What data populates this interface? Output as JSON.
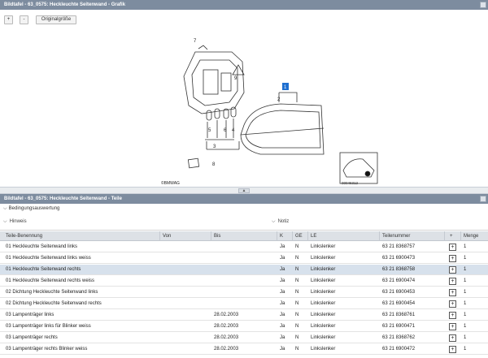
{
  "graphic_panel": {
    "title": "Bildtafel - 63_0575: Heckleuchte Seitenwand - Grafik",
    "toolbar": {
      "zoom_in": "+",
      "zoom_out": "-",
      "original_size": "Originalgröße"
    },
    "diagram": {
      "callouts": [
        "7",
        "9",
        "1",
        "2",
        "5",
        "6",
        "4",
        "3",
        "8"
      ],
      "copyright": "©BMWAG",
      "image_number": "00046312"
    }
  },
  "parts_panel": {
    "title": "Bildtafel - 63_0575: Heckleuchte Seitenwand - Teile",
    "conditions_label": "Bedingungsauswertung",
    "hinweis_label": "Hinweis",
    "notiz_label": "Notiz",
    "columns": {
      "name": "Teile-Benennung",
      "von": "Von",
      "bis": "Bis",
      "k": "K",
      "ge": "GE",
      "le": "LE",
      "teilenummer": "Teilenummer",
      "add": "+",
      "menge": "Menge"
    },
    "rows": [
      {
        "name": "01 Heckleuchte Seitenwand links",
        "von": "",
        "bis": "",
        "k": "Ja",
        "ge": "N",
        "le": "Linkslenker",
        "teilenummer": "63 21 8368757",
        "menge": "1",
        "selected": false
      },
      {
        "name": "01 Heckleuchte Seitenwand links weiss",
        "von": "",
        "bis": "",
        "k": "Ja",
        "ge": "N",
        "le": "Linkslenker",
        "teilenummer": "63 21 6900473",
        "menge": "1",
        "selected": false
      },
      {
        "name": "01 Heckleuchte Seitenwand rechts",
        "von": "",
        "bis": "",
        "k": "Ja",
        "ge": "N",
        "le": "Linkslenker",
        "teilenummer": "63 21 8368758",
        "menge": "1",
        "selected": true
      },
      {
        "name": "01 Heckleuchte Seitenwand rechts weiss",
        "von": "",
        "bis": "",
        "k": "Ja",
        "ge": "N",
        "le": "Linkslenker",
        "teilenummer": "63 21 6900474",
        "menge": "1",
        "selected": false
      },
      {
        "name": "02 Dichtung Heckleuchte Seitenwand links",
        "von": "",
        "bis": "",
        "k": "Ja",
        "ge": "N",
        "le": "Linkslenker",
        "teilenummer": "63 21 6900453",
        "menge": "1",
        "selected": false
      },
      {
        "name": "02 Dichtung Heckleuchte Seitenwand rechts",
        "von": "",
        "bis": "",
        "k": "Ja",
        "ge": "N",
        "le": "Linkslenker",
        "teilenummer": "63 21 6900454",
        "menge": "1",
        "selected": false
      },
      {
        "name": "03 Lampenträger links",
        "von": "",
        "bis": "28.02.2003",
        "k": "Ja",
        "ge": "N",
        "le": "Linkslenker",
        "teilenummer": "63 21 8368761",
        "menge": "1",
        "selected": false
      },
      {
        "name": "03 Lampenträger links für Blinker weiss",
        "von": "",
        "bis": "28.02.2003",
        "k": "Ja",
        "ge": "N",
        "le": "Linkslenker",
        "teilenummer": "63 21 6900471",
        "menge": "1",
        "selected": false
      },
      {
        "name": "03 Lampenträger rechts",
        "von": "",
        "bis": "28.02.2003",
        "k": "Ja",
        "ge": "N",
        "le": "Linkslenker",
        "teilenummer": "63 21 8368762",
        "menge": "1",
        "selected": false
      },
      {
        "name": "03 Lampenträger rechts Blinker weiss",
        "von": "",
        "bis": "28.02.2003",
        "k": "Ja",
        "ge": "N",
        "le": "Linkslenker",
        "teilenummer": "63 21 6900472",
        "menge": "1",
        "selected": false
      }
    ]
  },
  "colors": {
    "titlebar": "#7d8c9f",
    "header": "#dde1e6",
    "selected_row": "#d7e1ec",
    "callout_highlight": "#1e6fd0"
  }
}
